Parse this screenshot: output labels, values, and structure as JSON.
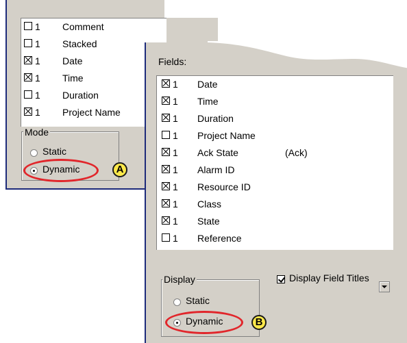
{
  "panel_a": {
    "fields": [
      {
        "checked": false,
        "num": "1",
        "label": "Comment"
      },
      {
        "checked": false,
        "num": "1",
        "label": "Stacked"
      },
      {
        "checked": true,
        "num": "1",
        "label": "Date"
      },
      {
        "checked": true,
        "num": "1",
        "label": "Time"
      },
      {
        "checked": false,
        "num": "1",
        "label": "Duration"
      },
      {
        "checked": true,
        "num": "1",
        "label": "Project Name"
      }
    ],
    "mode": {
      "title": "Mode",
      "options": [
        {
          "label": "Static",
          "selected": false
        },
        {
          "label": "Dynamic",
          "selected": true
        }
      ]
    },
    "badge": "A"
  },
  "panel_b": {
    "fields_label": "Fields:",
    "fields": [
      {
        "checked": true,
        "num": "1",
        "label": "Date",
        "extra": ""
      },
      {
        "checked": true,
        "num": "1",
        "label": "Time",
        "extra": ""
      },
      {
        "checked": true,
        "num": "1",
        "label": "Duration",
        "extra": ""
      },
      {
        "checked": false,
        "num": "1",
        "label": "Project Name",
        "extra": ""
      },
      {
        "checked": true,
        "num": "1",
        "label": "Ack State",
        "extra": "(Ack)"
      },
      {
        "checked": true,
        "num": "1",
        "label": "Alarm ID",
        "extra": ""
      },
      {
        "checked": true,
        "num": "1",
        "label": "Resource ID",
        "extra": ""
      },
      {
        "checked": true,
        "num": "1",
        "label": "Class",
        "extra": ""
      },
      {
        "checked": true,
        "num": "1",
        "label": "State",
        "extra": ""
      },
      {
        "checked": false,
        "num": "1",
        "label": "Reference",
        "extra": ""
      }
    ],
    "display": {
      "title": "Display",
      "options": [
        {
          "label": "Static",
          "selected": false
        },
        {
          "label": "Dynamic",
          "selected": true
        }
      ]
    },
    "display_field_titles": {
      "label": "Display Field Titles",
      "checked": true
    },
    "badge": "B"
  },
  "colors": {
    "panel_bg": "#d4d0c8",
    "panel_border": "#1c2a7a",
    "highlight_ring": "#e1262b",
    "badge_fill": "#ffe94a"
  }
}
